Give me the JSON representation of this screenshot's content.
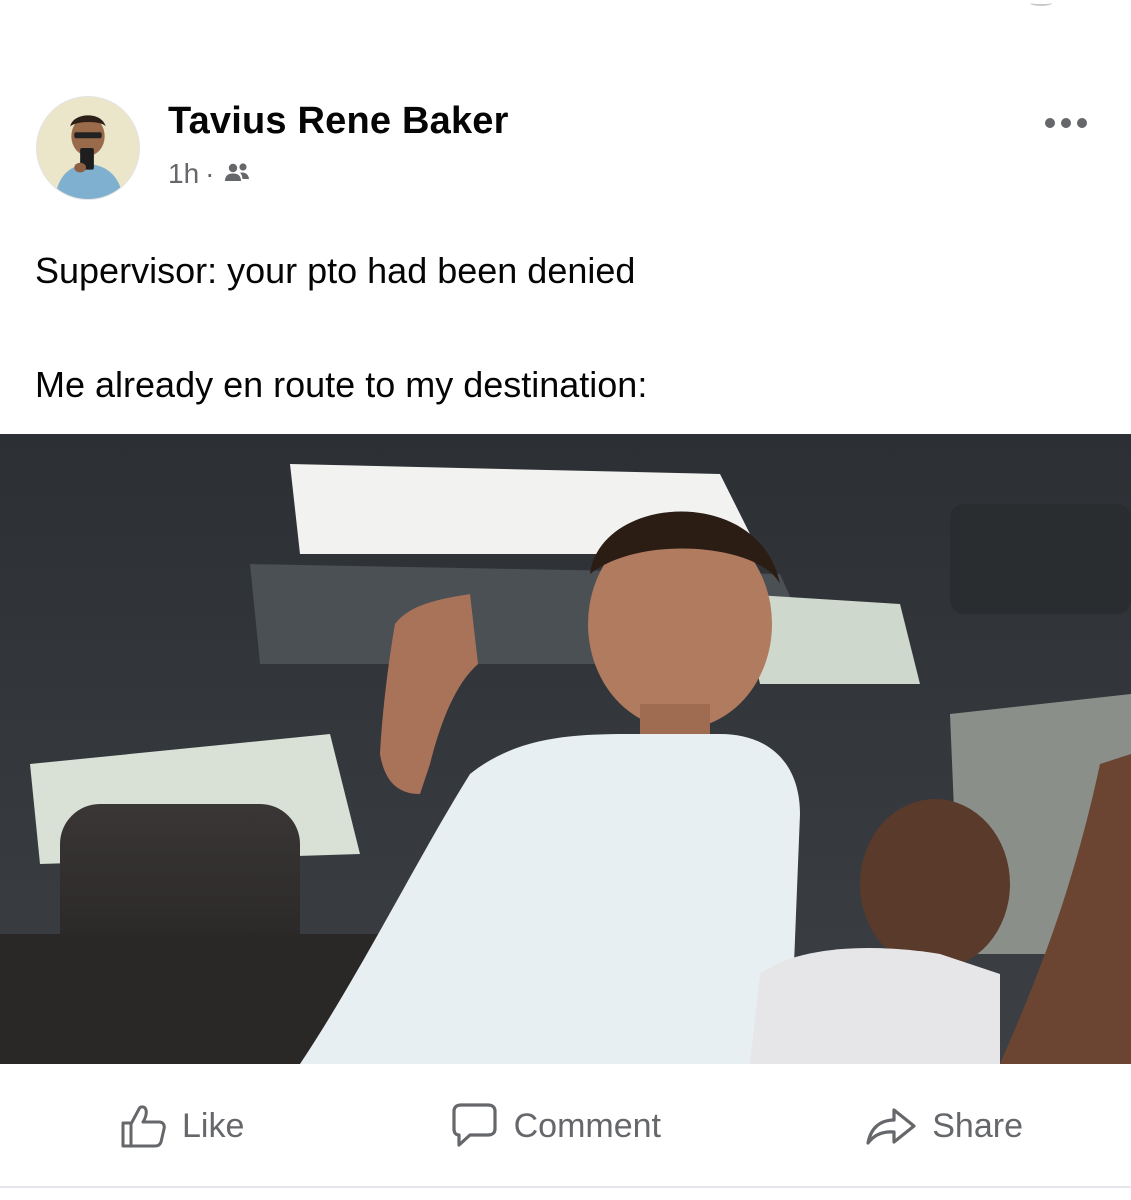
{
  "post": {
    "author_name": "Tavius Rene Baker",
    "timestamp": "1h",
    "separator": "·",
    "audience_icon": "friends-icon",
    "more_icon": "more-options-icon",
    "text_lines": [
      "Supervisor: your pto had been denied",
      "Me already en route to my destination:"
    ],
    "photo_icon": "post-photo"
  },
  "actions": {
    "like_label": "Like",
    "comment_label": "Comment",
    "share_label": "Share",
    "like_icon": "thumbs-up-icon",
    "comment_icon": "speech-bubble-icon",
    "share_icon": "share-arrow-icon"
  },
  "colors": {
    "text_primary": "#050505",
    "text_secondary": "#65676b",
    "divider": "#e4e6eb",
    "background": "#ffffff"
  }
}
